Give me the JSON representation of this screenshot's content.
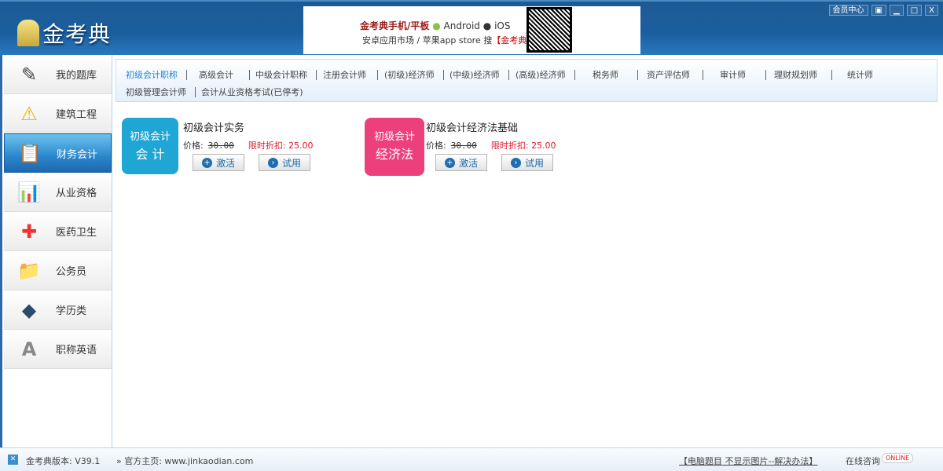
{
  "app": {
    "logo_text": "金考典"
  },
  "banner": {
    "headline": "金考典手机/平板",
    "android": "Android",
    "ios": "iOS",
    "subline": "安卓应用市场 / 苹果app store 搜",
    "brand": "【金考典】"
  },
  "window_controls": {
    "member_center": "会员中心",
    "skin": "▣",
    "minimize": "▁",
    "maximize": "□",
    "close": "X"
  },
  "sidebar": {
    "items": [
      {
        "label": "我的题库",
        "icon": "✎"
      },
      {
        "label": "建筑工程",
        "icon": "⚠"
      },
      {
        "label": "财务会计",
        "icon": "📋"
      },
      {
        "label": "从业资格",
        "icon": "📊"
      },
      {
        "label": "医药卫生",
        "icon": "✚"
      },
      {
        "label": "公务员",
        "icon": "📁"
      },
      {
        "label": "学历类",
        "icon": "◆"
      },
      {
        "label": "职称英语",
        "icon": "A"
      }
    ]
  },
  "tabs": [
    "初级会计职称",
    "高级会计",
    "中级会计职称",
    "注册会计师",
    "(初级)经济师",
    "(中级)经济师",
    "(高级)经济师",
    "税务师",
    "资产评估师",
    "审计师",
    "理财规划师",
    "统计师",
    "初级管理会计师",
    "会计从业资格考试(已停考)"
  ],
  "products": [
    {
      "cover_line1": "初级会计",
      "cover_line2": "会 计",
      "title": "初级会计实务",
      "price_label": "价格:",
      "price": "30.00",
      "discount_label": "限时折扣:",
      "discount": "25.00",
      "activate": "激活",
      "trial": "试用",
      "color": "#1fa6d4"
    },
    {
      "cover_line1": "初级会计",
      "cover_line2": "经济法",
      "title": "初级会计经济法基础",
      "price_label": "价格:",
      "price": "30.00",
      "discount_label": "限时折扣:",
      "discount": "25.00",
      "activate": "激活",
      "trial": "试用",
      "color": "#ee3f7d"
    }
  ],
  "footer": {
    "version": "金考典版本: V39.1",
    "homepage": "» 官方主页: www.jinkaodian.com",
    "help_link": "【电脑题目 不显示图片--解决办法】",
    "consult": "在线咨询",
    "online": "ONLINE"
  }
}
